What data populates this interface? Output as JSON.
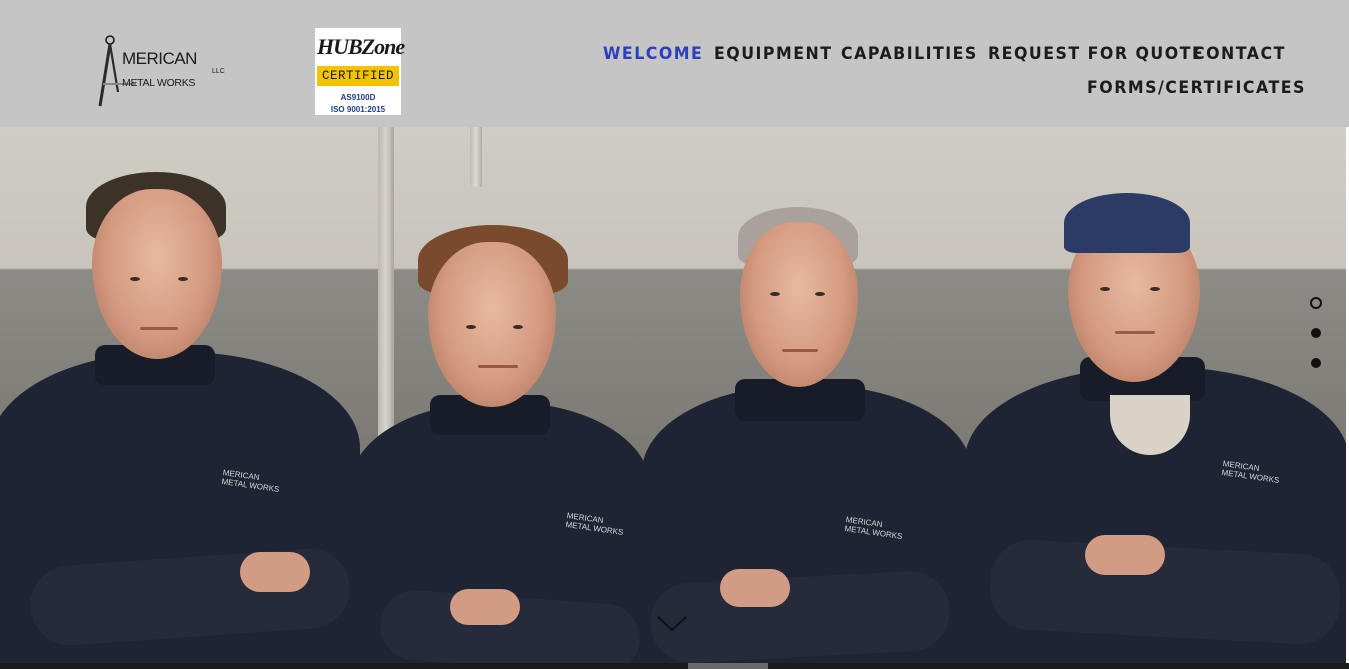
{
  "header": {
    "logo": {
      "line1": "MERICAN",
      "line2": "METAL WORKS",
      "suffix": "LLC",
      "initial": "A"
    },
    "certification": {
      "title": "HUBZone",
      "band": "CERTIFIED",
      "line1": "AS9100D",
      "line2": "ISO 9001:2015",
      "band_color": "#f3c300"
    }
  },
  "nav": {
    "items": [
      {
        "label": "WELCOME",
        "active": true
      },
      {
        "label": "EQUIPMENT",
        "active": false
      },
      {
        "label": "CAPABILITIES",
        "active": false
      },
      {
        "label": "REQUEST FOR QUOTE",
        "active": false
      },
      {
        "label": "CONTACT",
        "active": false
      },
      {
        "label": "FORMS/CERTIFICATES",
        "active": false
      }
    ],
    "active_color": "#2b3fbf",
    "text_color": "#1c1c1c"
  },
  "hero": {
    "image": "team-photo",
    "shirt_logo": {
      "line1": "MERICAN",
      "line2": "METAL WORKS"
    },
    "slides": {
      "count": 3,
      "active_index": 0
    },
    "scroll_icon": "chevron-down-icon"
  },
  "colors": {
    "header_bg": "#c5c5c5",
    "shirt": "#1e2433"
  }
}
